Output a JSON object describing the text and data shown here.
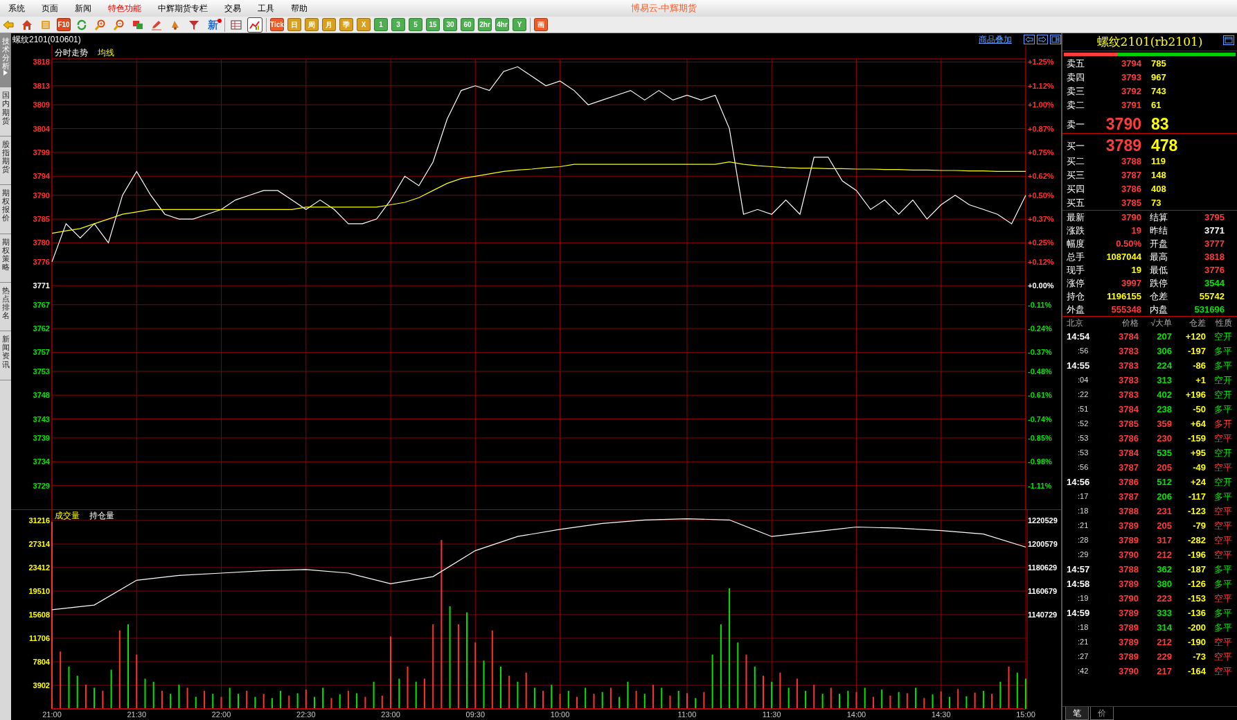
{
  "window": {
    "title": "博易云-中辉期货"
  },
  "menu": [
    {
      "label": "系统",
      "highlighted": false
    },
    {
      "label": "页面",
      "highlighted": false
    },
    {
      "label": "新闻",
      "highlighted": false
    },
    {
      "label": "特色功能",
      "highlighted": true
    },
    {
      "label": "中辉期货专栏",
      "highlighted": false
    },
    {
      "label": "交易",
      "highlighted": false
    },
    {
      "label": "工具",
      "highlighted": false
    },
    {
      "label": "帮助",
      "highlighted": false
    }
  ],
  "toolbar": [
    {
      "kind": "icon",
      "selected": false
    },
    {
      "kind": "icon",
      "selected": false
    },
    {
      "kind": "icon",
      "selected": false
    },
    {
      "kind": "text",
      "label": "F10",
      "color": "#e04a20",
      "selected": false
    },
    {
      "kind": "icon",
      "selected": false
    },
    {
      "kind": "icon",
      "selected": false
    },
    {
      "kind": "icon",
      "selected": false
    },
    {
      "kind": "icon",
      "selected": false
    },
    {
      "kind": "icon",
      "selected": false
    },
    {
      "kind": "icon",
      "selected": false
    },
    {
      "kind": "icon",
      "selected": false
    },
    {
      "kind": "flagged",
      "label": "新",
      "color": "#2a6fd6",
      "selected": false
    },
    {
      "kind": "separator"
    },
    {
      "kind": "icon",
      "selected": false
    },
    {
      "kind": "icon",
      "selected": true
    },
    {
      "kind": "separator"
    },
    {
      "kind": "text",
      "label": "Tick",
      "color": "#f05a28",
      "selected": false
    },
    {
      "kind": "text",
      "label": "日",
      "color": "#d9a020",
      "selected": false
    },
    {
      "kind": "text",
      "label": "周",
      "color": "#d9a020",
      "selected": false
    },
    {
      "kind": "text",
      "label": "月",
      "color": "#d9a020",
      "selected": false
    },
    {
      "kind": "text",
      "label": "季",
      "color": "#d9a020",
      "selected": false
    },
    {
      "kind": "text",
      "label": "X",
      "color": "#d9a020",
      "selected": false
    },
    {
      "kind": "text",
      "label": "1",
      "color": "#4caf50",
      "selected": false
    },
    {
      "kind": "text",
      "label": "3",
      "color": "#4caf50",
      "selected": false
    },
    {
      "kind": "text",
      "label": "5",
      "color": "#4caf50",
      "selected": false
    },
    {
      "kind": "text",
      "label": "15",
      "color": "#4caf50",
      "selected": false
    },
    {
      "kind": "text",
      "label": "30",
      "color": "#4caf50",
      "selected": false
    },
    {
      "kind": "text",
      "label": "60",
      "color": "#4caf50",
      "selected": false
    },
    {
      "kind": "text",
      "label": "2hr",
      "color": "#4caf50",
      "selected": false
    },
    {
      "kind": "text",
      "label": "4hr",
      "color": "#4caf50",
      "selected": false
    },
    {
      "kind": "text",
      "label": "Y",
      "color": "#4caf50",
      "selected": false
    },
    {
      "kind": "separator"
    },
    {
      "kind": "text",
      "label": "画",
      "color": "#f05a28",
      "selected": false
    }
  ],
  "side_tabs": [
    {
      "label": "技术分析",
      "selected": true
    },
    {
      "label": "国内期货",
      "selected": false
    },
    {
      "label": "股指期货",
      "selected": false
    },
    {
      "label": "期权报价",
      "selected": false
    },
    {
      "label": "期权策略",
      "selected": false
    },
    {
      "label": "热点排名",
      "selected": false
    },
    {
      "label": "新闻资讯",
      "selected": false
    }
  ],
  "chart_header": {
    "instrument": "螺纹2101(010601)",
    "overlay_link": "商品叠加"
  },
  "price_panel": {
    "right_axis": [
      {
        "label": "+1.25%",
        "color": "#ff3232"
      },
      {
        "label": "+1.12%",
        "color": "#ff3232"
      },
      {
        "label": "+1.00%",
        "color": "#ff3232"
      },
      {
        "label": "+0.87%",
        "color": "#ff3232"
      },
      {
        "label": "+0.75%",
        "color": "#ff3232"
      },
      {
        "label": "+0.62%",
        "color": "#ff3232"
      },
      {
        "label": "+0.50%",
        "color": "#ff3232"
      },
      {
        "label": "+0.37%",
        "color": "#ff3232"
      },
      {
        "label": "+0.25%",
        "color": "#ff3232"
      },
      {
        "label": "+0.12%",
        "color": "#ff3232"
      },
      {
        "label": "+0.00%",
        "color": "#ffffff"
      },
      {
        "label": "-0.11%",
        "color": "#00e600"
      },
      {
        "label": "-0.24%",
        "color": "#00e600"
      },
      {
        "label": "-0.37%",
        "color": "#00e600"
      },
      {
        "label": "-0.48%",
        "color": "#00e600"
      },
      {
        "label": "-0.61%",
        "color": "#00e600"
      },
      {
        "label": "-0.74%",
        "color": "#00e600"
      },
      {
        "label": "-0.85%",
        "color": "#00e600"
      },
      {
        "label": "-0.98%",
        "color": "#00e600"
      },
      {
        "label": "-1.11%",
        "color": "#00e600"
      }
    ],
    "chart_data": {
      "type": "line",
      "grid": true,
      "series": [
        {
          "name": "分时走势",
          "color": "#ffffff",
          "values": [
            3776,
            3784,
            3781,
            3784,
            3780,
            3790,
            3795,
            3790,
            3786,
            3785,
            3785,
            3786,
            3787,
            3789,
            3790,
            3791,
            3791,
            3789,
            3787,
            3789,
            3787,
            3784,
            3784,
            3785,
            3789,
            3794,
            3792,
            3797,
            3806,
            3812,
            3813,
            3812,
            3816,
            3817,
            3815,
            3813,
            3814,
            3812,
            3809,
            3810,
            3811,
            3812,
            3810,
            3812,
            3810,
            3811,
            3810,
            3811,
            3804,
            3786,
            3787,
            3786,
            3789,
            3786,
            3798,
            3798,
            3793,
            3791,
            3787,
            3789,
            3786,
            3789,
            3785,
            3788,
            3790,
            3788,
            3787,
            3786,
            3784,
            3790
          ]
        },
        {
          "name": "均线",
          "color": "#ffff00",
          "values": [
            3782,
            3782.5,
            3783,
            3784,
            3785,
            3786,
            3786.5,
            3787,
            3787,
            3787,
            3787,
            3787,
            3787,
            3787,
            3787,
            3787,
            3787,
            3787,
            3787.5,
            3787.5,
            3787.5,
            3787.5,
            3787.5,
            3787.5,
            3788,
            3788.5,
            3789.5,
            3791,
            3792.5,
            3793.5,
            3794,
            3794.5,
            3795,
            3795.3,
            3795.5,
            3795.8,
            3796,
            3796.5,
            3796.5,
            3796.5,
            3796.5,
            3796.5,
            3796.5,
            3796.5,
            3796.5,
            3796.5,
            3796.5,
            3796.5,
            3797,
            3796.5,
            3796.2,
            3796,
            3795.8,
            3795.7,
            3795.7,
            3795.6,
            3795.6,
            3795.5,
            3795.5,
            3795.4,
            3795.4,
            3795.3,
            3795.3,
            3795.2,
            3795.2,
            3795.1,
            3795.1,
            3795,
            3795,
            3795
          ]
        }
      ],
      "ylim": [
        3724,
        3818.5
      ],
      "yticks": [
        {
          "value": 3818,
          "label": "3818"
        },
        {
          "value": 3813,
          "label": "3813"
        },
        {
          "value": 3809,
          "label": "3809"
        },
        {
          "value": 3804,
          "label": "3804"
        },
        {
          "value": 3799,
          "label": "3799"
        },
        {
          "value": 3794,
          "label": "3794"
        },
        {
          "value": 3790,
          "label": "3790"
        },
        {
          "value": 3785,
          "label": "3785"
        },
        {
          "value": 3780,
          "label": "3780"
        },
        {
          "value": 3776,
          "label": "3776"
        },
        {
          "value": 3771,
          "label": "3771"
        },
        {
          "value": 3767,
          "label": "3767"
        },
        {
          "value": 3762,
          "label": "3762"
        },
        {
          "value": 3757,
          "label": "3757"
        },
        {
          "value": 3753,
          "label": "3753"
        },
        {
          "value": 3748,
          "label": "3748"
        },
        {
          "value": 3743,
          "label": "3743"
        },
        {
          "value": 3739,
          "label": "3739"
        },
        {
          "value": 3734,
          "label": "3734"
        },
        {
          "value": 3729,
          "label": "3729"
        }
      ]
    }
  },
  "volume_panel": {
    "legend": "成交量",
    "chart_data": {
      "type": "bar",
      "grid": true,
      "series": [
        {
          "color": "#ff3232",
          "values": [
            31000,
            9500,
            null,
            null,
            4000,
            null,
            3000,
            null,
            13000,
            null,
            9000,
            null,
            null,
            3000,
            null,
            null,
            3500,
            null,
            3000,
            null,
            2000,
            null,
            null,
            3000,
            null,
            2500,
            null,
            null,
            2200,
            null,
            3200,
            null,
            null,
            1800,
            null,
            3000,
            null,
            2000,
            null,
            2200,
            12000,
            null,
            7000,
            null,
            5000,
            14000,
            28000,
            null,
            14000,
            null,
            11000,
            null,
            13000,
            null,
            5500,
            null,
            6000,
            null,
            3000,
            null,
            2500,
            null,
            2000,
            null,
            2500,
            null,
            3500,
            null,
            null,
            3000,
            null,
            4000,
            null,
            2200,
            null,
            2600,
            null,
            2800,
            null,
            null,
            null,
            null,
            9000,
            null,
            5500,
            null,
            6000,
            null,
            5000,
            null,
            4000,
            null,
            3500,
            null,
            null,
            2800,
            null,
            2000,
            null,
            2200,
            null,
            2600,
            null,
            1800,
            null,
            2900,
            null,
            3300,
            null,
            2700,
            null,
            2500,
            null,
            7000,
            null,
            null
          ]
        },
        {
          "color": "#00e600",
          "values": [
            null,
            null,
            7000,
            5500,
            null,
            3500,
            null,
            6500,
            null,
            14000,
            null,
            5000,
            4500,
            null,
            2500,
            4000,
            null,
            2000,
            null,
            2500,
            null,
            3500,
            2500,
            null,
            2000,
            null,
            1800,
            3000,
            null,
            2600,
            null,
            2000,
            3500,
            null,
            2400,
            null,
            2600,
            null,
            4500,
            null,
            null,
            5000,
            null,
            4500,
            null,
            null,
            null,
            17000,
            null,
            16000,
            null,
            8000,
            null,
            7000,
            null,
            4500,
            null,
            3500,
            null,
            4000,
            null,
            3000,
            null,
            3500,
            null,
            2800,
            null,
            2000,
            4500,
            null,
            2500,
            null,
            3500,
            null,
            3000,
            null,
            1800,
            null,
            9000,
            14000,
            20000,
            11000,
            null,
            7000,
            null,
            4500,
            null,
            3500,
            null,
            3000,
            null,
            2500,
            null,
            2500,
            3000,
            null,
            3500,
            null,
            3200,
            null,
            2800,
            null,
            3500,
            null,
            2400,
            null,
            2000,
            null,
            2100,
            null,
            3000,
            null,
            4500,
            null,
            6000,
            5000
          ]
        }
      ],
      "ylim": [
        0,
        33060
      ],
      "yticks": [
        {
          "value": 3902,
          "label": "3902"
        },
        {
          "value": 7804,
          "label": "7804"
        },
        {
          "value": 11706,
          "label": "11706"
        },
        {
          "value": 15608,
          "label": "15608"
        },
        {
          "value": 19510,
          "label": "19510"
        },
        {
          "value": 23412,
          "label": "23412"
        },
        {
          "value": 27314,
          "label": "27314"
        },
        {
          "value": 31216,
          "label": "31216"
        }
      ]
    }
  },
  "open_interest": {
    "legend": "持仓量",
    "chart_data": {
      "type": "line",
      "series": [
        {
          "color": "#ffffff",
          "values": [
            1145000,
            1149000,
            1170000,
            1174000,
            1176000,
            1178000,
            1179000,
            1176000,
            1167000,
            1173000,
            1195000,
            1207000,
            1213000,
            1218000,
            1221000,
            1222000,
            1221000,
            1207000,
            1211000,
            1215000,
            1214000,
            1212000,
            1209000,
            1198000
          ]
        }
      ],
      "ylim": [
        1061070,
        1229965
      ],
      "yticks": [
        {
          "value": 1140729,
          "label": "1140729"
        },
        {
          "value": 1160679,
          "label": "1160679"
        },
        {
          "value": 1180629,
          "label": "1180629"
        },
        {
          "value": 1200579,
          "label": "1200579"
        },
        {
          "value": 1220529,
          "label": "1220529"
        }
      ]
    }
  },
  "time_axis": [
    "21:00",
    "21:30",
    "22:00",
    "22:30",
    "23:00",
    "09:30",
    "10:00",
    "11:00",
    "11:30",
    "14:00",
    "14:30",
    "15:00"
  ],
  "quote_panel": {
    "title": "螺纹2101(rb2101)",
    "ratio": {
      "level": 0.31
    },
    "asks": [
      {
        "label": "卖五",
        "price": "3794",
        "volume": "785",
        "kind": "level"
      },
      {
        "label": "卖四",
        "price": "3793",
        "volume": "967",
        "kind": "level"
      },
      {
        "label": "卖三",
        "price": "3792",
        "volume": "743",
        "kind": "level"
      },
      {
        "label": "卖二",
        "price": "3791",
        "volume": "61",
        "kind": "level"
      },
      {
        "label": "卖一",
        "price": "3790",
        "volume": "83",
        "kind": "best"
      }
    ],
    "bids": [
      {
        "label": "买一",
        "price": "3789",
        "volume": "478",
        "kind": "best"
      },
      {
        "label": "买二",
        "price": "3788",
        "volume": "119",
        "kind": "level"
      },
      {
        "label": "买三",
        "price": "3787",
        "volume": "148",
        "kind": "level"
      },
      {
        "label": "买四",
        "price": "3786",
        "volume": "408",
        "kind": "level"
      },
      {
        "label": "买五",
        "price": "3785",
        "volume": "73",
        "kind": "level"
      }
    ],
    "stats": [
      {
        "label": "最新",
        "value": "3790",
        "color": "#ff3c3c"
      },
      {
        "label": "结算",
        "value": "3795",
        "color": "#ff3c3c"
      },
      {
        "label": "涨跌",
        "value": "19",
        "color": "#ff3c3c"
      },
      {
        "label": "昨结",
        "value": "3771",
        "color": "#ffffff"
      },
      {
        "label": "幅度",
        "value": "0.50%",
        "color": "#ff3c3c"
      },
      {
        "label": "开盘",
        "value": "3777",
        "color": "#ff3c3c"
      },
      {
        "label": "总手",
        "value": "1087044",
        "color": "#ffff00"
      },
      {
        "label": "最高",
        "value": "3818",
        "color": "#ff3c3c"
      },
      {
        "label": "现手",
        "value": "19",
        "color": "#ffff00"
      },
      {
        "label": "最低",
        "value": "3776",
        "color": "#ff3c3c"
      },
      {
        "label": "涨停",
        "value": "3997",
        "color": "#ff3c3c"
      },
      {
        "label": "跌停",
        "value": "3544",
        "color": "#00e600"
      },
      {
        "label": "持仓",
        "value": "1196155",
        "color": "#ffff00"
      },
      {
        "label": "仓差",
        "value": "55742",
        "color": "#ffff00"
      },
      {
        "label": "外盘",
        "value": "555348",
        "color": "#ff3c3c"
      },
      {
        "label": "内盘",
        "value": "531696",
        "color": "#00e600"
      }
    ],
    "trades": {
      "columns": [
        "北京",
        "价格",
        "√大单",
        "仓差",
        "性质"
      ],
      "rows": [
        {
          "time": "14:54",
          "kind": "full",
          "price": "3784",
          "volume": "207",
          "oi_change": "+120",
          "nature": "空开",
          "color": "#00e600"
        },
        {
          "time": ":56",
          "kind": "second",
          "price": "3783",
          "volume": "306",
          "oi_change": "-197",
          "nature": "多平",
          "color": "#00e600"
        },
        {
          "time": "14:55",
          "kind": "full",
          "price": "3783",
          "volume": "224",
          "oi_change": "-86",
          "nature": "多平",
          "color": "#00e600"
        },
        {
          "time": ":04",
          "kind": "second",
          "price": "3783",
          "volume": "313",
          "oi_change": "+1",
          "nature": "空开",
          "color": "#00e600"
        },
        {
          "time": ":22",
          "kind": "second",
          "price": "3783",
          "volume": "402",
          "oi_change": "+196",
          "nature": "空开",
          "color": "#00e600"
        },
        {
          "time": ":51",
          "kind": "second",
          "price": "3784",
          "volume": "238",
          "oi_change": "-50",
          "nature": "多平",
          "color": "#00e600"
        },
        {
          "time": ":52",
          "kind": "second",
          "price": "3785",
          "volume": "359",
          "oi_change": "+64",
          "nature": "多开",
          "color": "#ff3c3c"
        },
        {
          "time": ":53",
          "kind": "second",
          "price": "3786",
          "volume": "230",
          "oi_change": "-159",
          "nature": "空平",
          "color": "#ff3c3c"
        },
        {
          "time": ":53",
          "kind": "second",
          "price": "3784",
          "volume": "535",
          "oi_change": "+95",
          "nature": "空开",
          "color": "#00e600"
        },
        {
          "time": ":56",
          "kind": "second",
          "price": "3787",
          "volume": "205",
          "oi_change": "-49",
          "nature": "空平",
          "color": "#ff3c3c"
        },
        {
          "time": "14:56",
          "kind": "full",
          "price": "3786",
          "volume": "512",
          "oi_change": "+24",
          "nature": "空开",
          "color": "#00e600"
        },
        {
          "time": ":17",
          "kind": "second",
          "price": "3787",
          "volume": "206",
          "oi_change": "-117",
          "nature": "多平",
          "color": "#00e600"
        },
        {
          "time": ":18",
          "kind": "second",
          "price": "3788",
          "volume": "231",
          "oi_change": "-123",
          "nature": "空平",
          "color": "#ff3c3c"
        },
        {
          "time": ":21",
          "kind": "second",
          "price": "3789",
          "volume": "205",
          "oi_change": "-79",
          "nature": "空平",
          "color": "#ff3c3c"
        },
        {
          "time": ":28",
          "kind": "second",
          "price": "3789",
          "volume": "317",
          "oi_change": "-282",
          "nature": "空平",
          "color": "#ff3c3c"
        },
        {
          "time": ":29",
          "kind": "second",
          "price": "3790",
          "volume": "212",
          "oi_change": "-196",
          "nature": "空平",
          "color": "#ff3c3c"
        },
        {
          "time": "14:57",
          "kind": "full",
          "price": "3788",
          "volume": "362",
          "oi_change": "-187",
          "nature": "多平",
          "color": "#00e600"
        },
        {
          "time": "14:58",
          "kind": "full",
          "price": "3789",
          "volume": "380",
          "oi_change": "-126",
          "nature": "多平",
          "color": "#00e600"
        },
        {
          "time": ":19",
          "kind": "second",
          "price": "3790",
          "volume": "223",
          "oi_change": "-153",
          "nature": "空平",
          "color": "#ff3c3c"
        },
        {
          "time": "14:59",
          "kind": "full",
          "price": "3789",
          "volume": "333",
          "oi_change": "-136",
          "nature": "多平",
          "color": "#00e600"
        },
        {
          "time": ":18",
          "kind": "second",
          "price": "3789",
          "volume": "314",
          "oi_change": "-200",
          "nature": "多平",
          "color": "#00e600"
        },
        {
          "time": ":21",
          "kind": "second",
          "price": "3789",
          "volume": "212",
          "oi_change": "-190",
          "nature": "空平",
          "color": "#ff3c3c"
        },
        {
          "time": ":27",
          "kind": "second",
          "price": "3789",
          "volume": "229",
          "oi_change": "-73",
          "nature": "空平",
          "color": "#ff3c3c"
        },
        {
          "time": ":42",
          "kind": "second",
          "price": "3790",
          "volume": "217",
          "oi_change": "-164",
          "nature": "空平",
          "color": "#ff3c3c"
        }
      ]
    },
    "bottom_tabs": [
      {
        "label": "笔",
        "selected": true
      },
      {
        "label": "价",
        "selected": false
      }
    ]
  }
}
